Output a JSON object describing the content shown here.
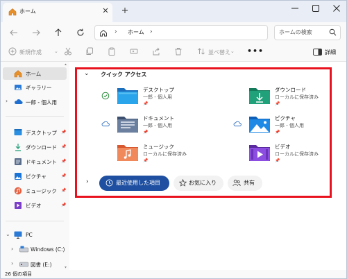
{
  "window": {
    "tab_title": "ホーム",
    "icons": {
      "tab": "home-icon",
      "tab_close": "close-icon",
      "new_tab": "plus-icon",
      "minimize": "minimize-icon",
      "maximize": "maximize-icon",
      "close": "close-icon"
    }
  },
  "address": {
    "location": "ホーム",
    "chevron": "›",
    "search_placeholder": "ホームの検索",
    "icons": {
      "back": "arrow-left-icon",
      "forward": "arrow-right-icon",
      "up": "arrow-up-icon",
      "refresh": "refresh-icon",
      "home": "home-outline-icon",
      "search": "search-icon"
    }
  },
  "toolbar": {
    "new_label": "新規作成",
    "sort_label": "並べ替え",
    "more_label": "•••",
    "details_label": "詳細",
    "icons": [
      "cut-icon",
      "copy-icon",
      "paste-icon",
      "rename-icon",
      "share-icon",
      "delete-icon",
      "sort-icon",
      "details-pane-icon"
    ]
  },
  "sidebar": {
    "home": "ホーム",
    "gallery": "ギャラリー",
    "onedrive": "一郎 - 個人用",
    "pinned": [
      {
        "label": "デスクトップ",
        "icon": "desktop-folder-icon"
      },
      {
        "label": "ダウンロード",
        "icon": "download-icon"
      },
      {
        "label": "ドキュメント",
        "icon": "documents-folder-icon"
      },
      {
        "label": "ピクチャ",
        "icon": "pictures-folder-icon"
      },
      {
        "label": "ミュージック",
        "icon": "music-folder-icon"
      },
      {
        "label": "ビデオ",
        "icon": "videos-folder-icon"
      }
    ],
    "pc": "PC",
    "drive_c": "Windows (C:)",
    "drive_e": "図書 (E:)",
    "pin_glyph": "📌"
  },
  "quick_access": {
    "title": "クイック アクセス",
    "items": [
      {
        "name": "デスクトップ",
        "location": "一郎 - 個人用",
        "status": "synced-check-icon",
        "icon": "desktop-folder-icon"
      },
      {
        "name": "ダウンロード",
        "location": "ローカルに保存済み",
        "status": "",
        "icon": "download-folder-icon"
      },
      {
        "name": "ドキュメント",
        "location": "一郎 - 個人用",
        "status": "cloud-icon",
        "icon": "documents-folder-icon"
      },
      {
        "name": "ピクチャ",
        "location": "一郎 - 個人用",
        "status": "cloud-icon",
        "icon": "pictures-folder-icon"
      },
      {
        "name": "ミュージック",
        "location": "ローカルに保存済み",
        "status": "",
        "icon": "music-folder-icon"
      },
      {
        "name": "ビデオ",
        "location": "ローカルに保存済み",
        "status": "",
        "icon": "videos-folder-icon"
      }
    ]
  },
  "section_tabs": {
    "recent": "最近使用した項目",
    "favorites": "お気に入り",
    "shared": "共有"
  },
  "status": {
    "item_count": "26 個の項目"
  },
  "colors": {
    "accent": "#1e4fa0",
    "highlight": "#e8121f",
    "titlebar": "#e9eef6"
  }
}
